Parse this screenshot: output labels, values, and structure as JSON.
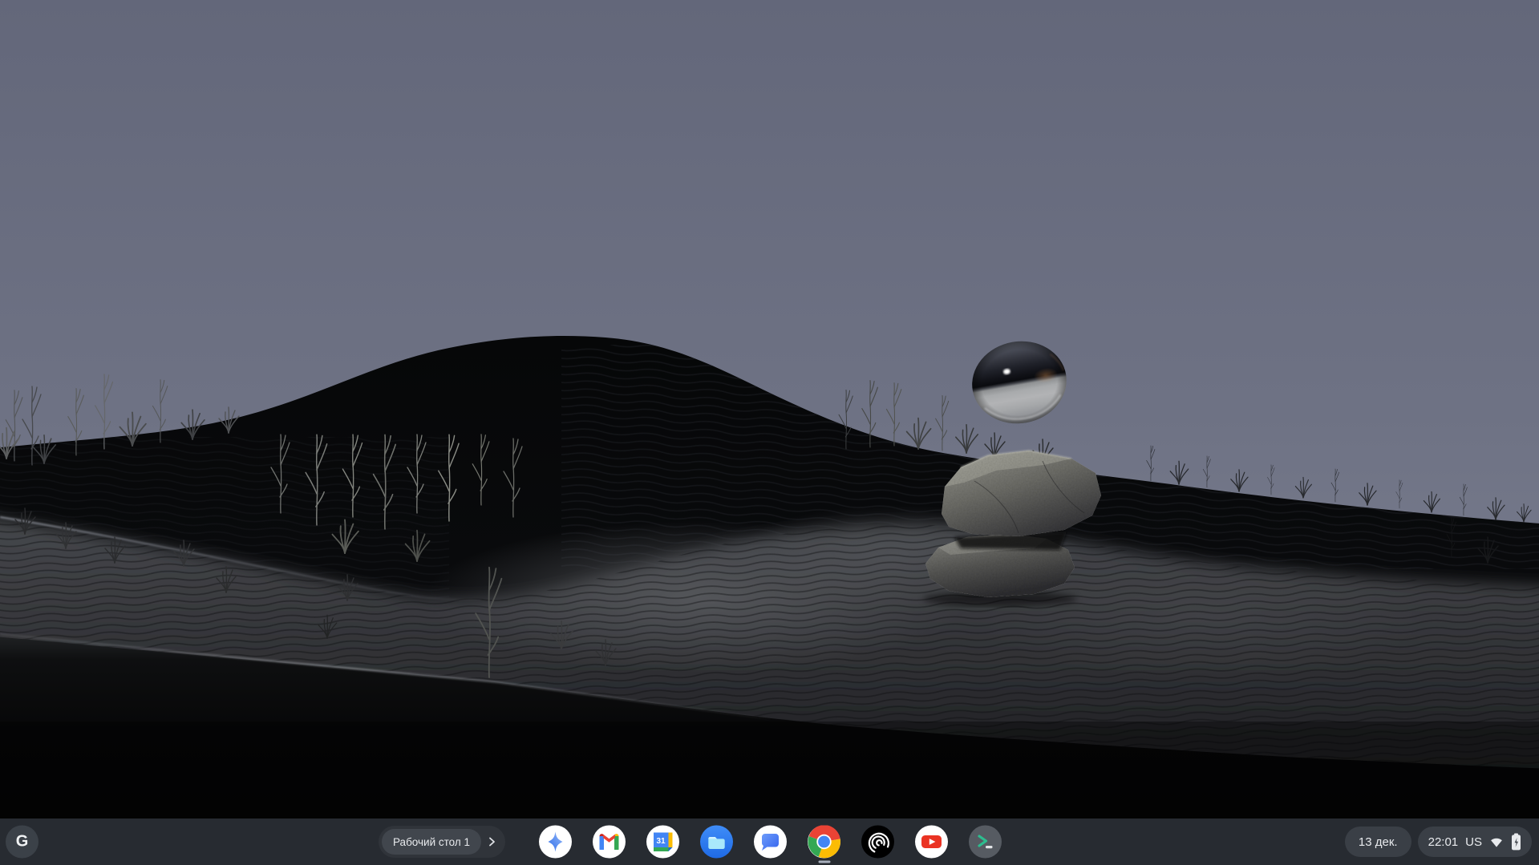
{
  "shelf": {
    "launcher_label": "G",
    "desk_label": "Рабочий стол 1",
    "apps": [
      {
        "name": "google-assistant"
      },
      {
        "name": "gmail"
      },
      {
        "name": "google-calendar"
      },
      {
        "name": "files"
      },
      {
        "name": "google-messages"
      },
      {
        "name": "google-chrome",
        "running": true
      },
      {
        "name": "screencast"
      },
      {
        "name": "youtube"
      },
      {
        "name": "terminal"
      }
    ]
  },
  "tray": {
    "date": "13 дек.",
    "time": "22:01",
    "keyboard_layout": "US",
    "wifi": "full",
    "battery": "charging"
  },
  "colors": {
    "shelf_bg": "#272b31",
    "pill_bg": "#3a3f46",
    "text": "#e8eaed",
    "running_indicator": "#a9b0bd"
  }
}
